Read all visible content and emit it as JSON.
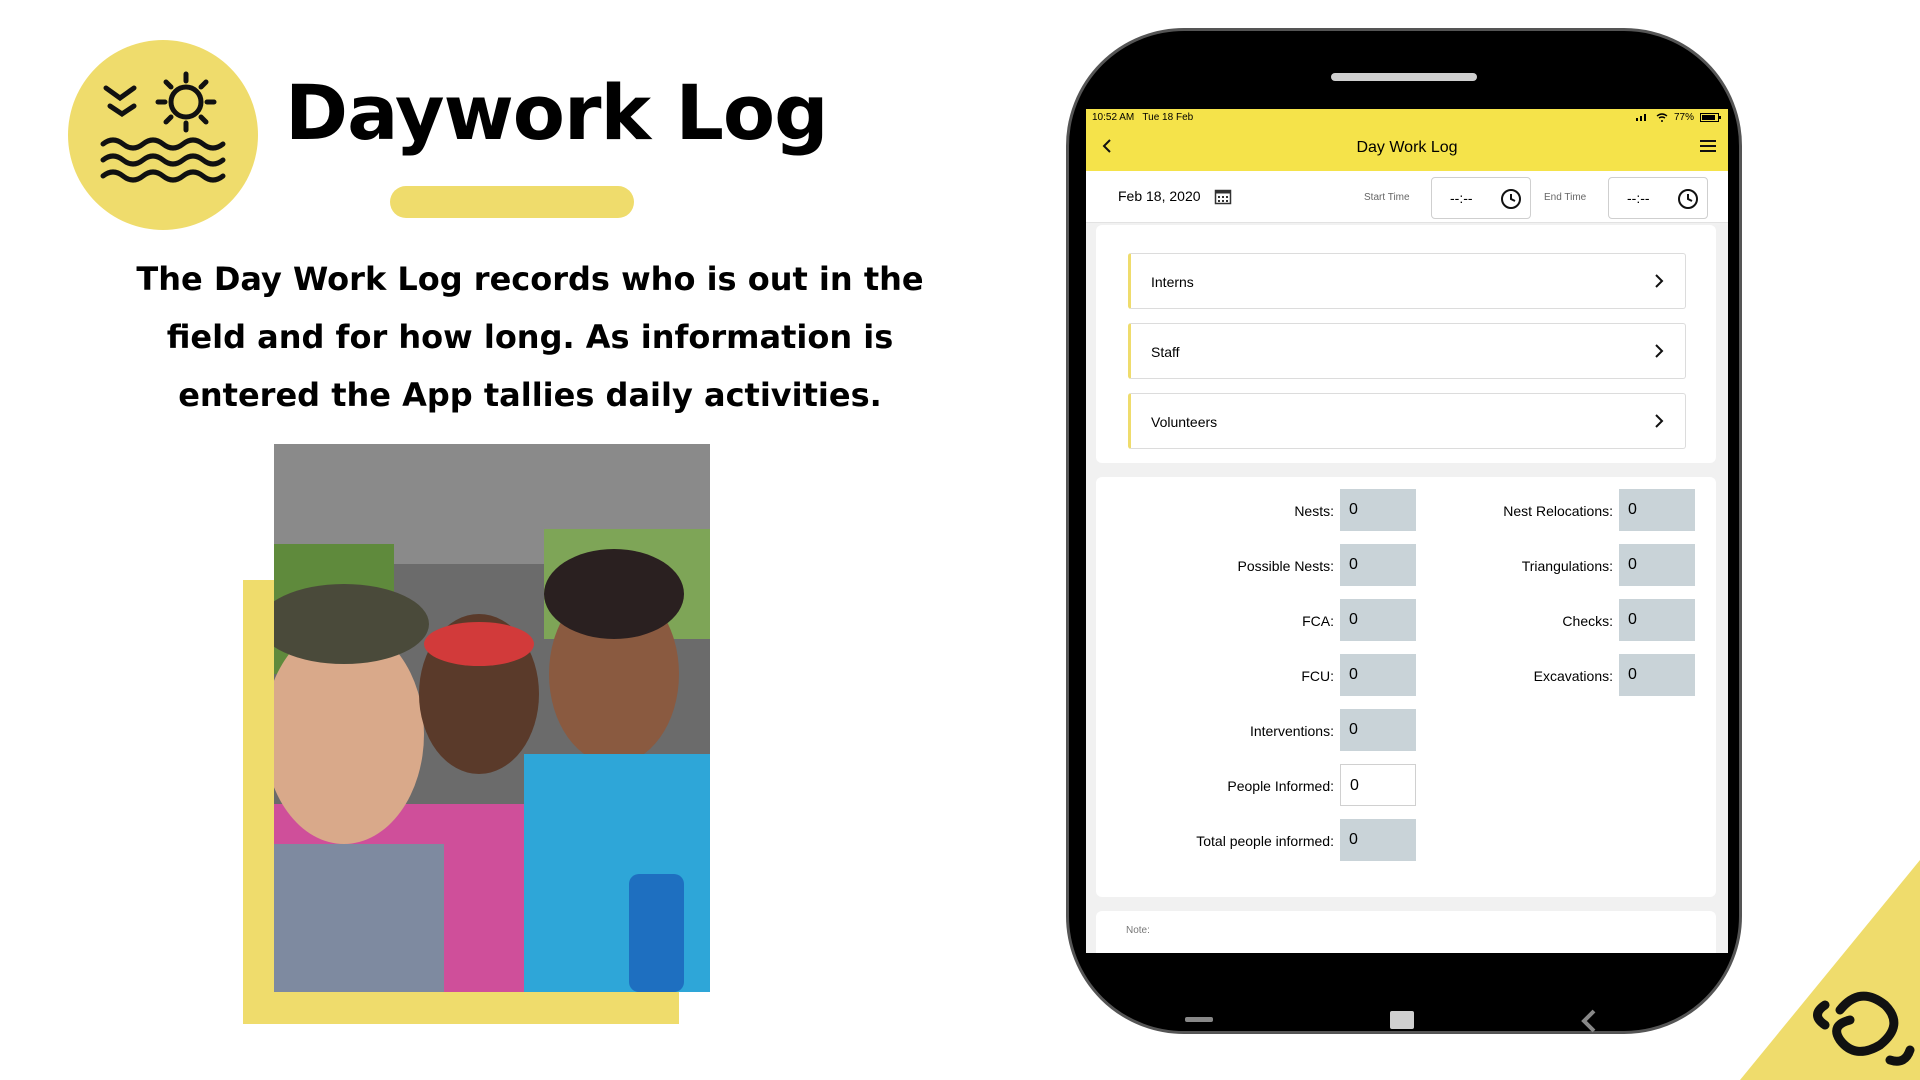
{
  "slide": {
    "title": "Daywork Log",
    "description": "The Day Work Log records who is out in the field and for how long. As information is entered the App tallies daily activities."
  },
  "colors": {
    "accent": "#efdc6c",
    "app_bar": "#f5e34a",
    "field_fill": "#c9d3d8"
  },
  "app": {
    "status_bar": {
      "time": "10:52 AM",
      "date": "Tue 18 Feb",
      "battery": "77%"
    },
    "header": {
      "title": "Day Work Log",
      "back_icon": "chevron-left-icon",
      "menu_icon": "hamburger-menu-icon"
    },
    "date_bar": {
      "date": "Feb 18, 2020",
      "start_time_label": "Start Time",
      "start_time_value": "--:--",
      "end_time_label": "End Time",
      "end_time_value": "--:--"
    },
    "groups": [
      "Interns",
      "Staff",
      "Volunteers"
    ],
    "fields_left": [
      {
        "label": "Nests:",
        "value": "0"
      },
      {
        "label": "Possible Nests:",
        "value": "0"
      },
      {
        "label": "FCA:",
        "value": "0"
      },
      {
        "label": "FCU:",
        "value": "0"
      },
      {
        "label": "Interventions:",
        "value": "0"
      },
      {
        "label": "People Informed:",
        "value": "0"
      },
      {
        "label": "Total people informed:",
        "value": "0"
      }
    ],
    "fields_right": [
      {
        "label": "Nest Relocations:",
        "value": "0"
      },
      {
        "label": "Triangulations:",
        "value": "0"
      },
      {
        "label": "Checks:",
        "value": "0"
      },
      {
        "label": "Excavations:",
        "value": "0"
      }
    ],
    "note_label": "Note:"
  }
}
